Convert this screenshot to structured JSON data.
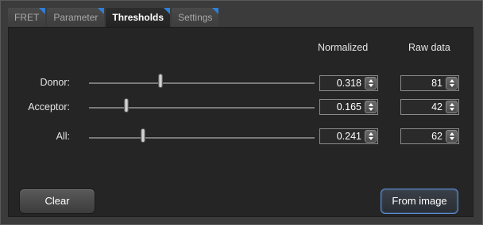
{
  "tabs": [
    {
      "label": "FRET"
    },
    {
      "label": "Parameter"
    },
    {
      "label": "Thresholds"
    },
    {
      "label": "Settings"
    }
  ],
  "active_tab": "Thresholds",
  "columns": {
    "normalized": "Normalized",
    "raw": "Raw data"
  },
  "rows": [
    {
      "label": "Donor:",
      "normalized": "0.318",
      "raw": "81",
      "slider_fraction": 0.318
    },
    {
      "label": "Acceptor:",
      "normalized": "0.165",
      "raw": "42",
      "slider_fraction": 0.165
    },
    {
      "label": "All:",
      "normalized": "0.241",
      "raw": "62",
      "slider_fraction": 0.241
    }
  ],
  "buttons": {
    "clear": "Clear",
    "from_image": "From image"
  },
  "colors": {
    "tab_corner_accent": "#2f7fd8",
    "active_button_border": "#5d8fd0"
  }
}
